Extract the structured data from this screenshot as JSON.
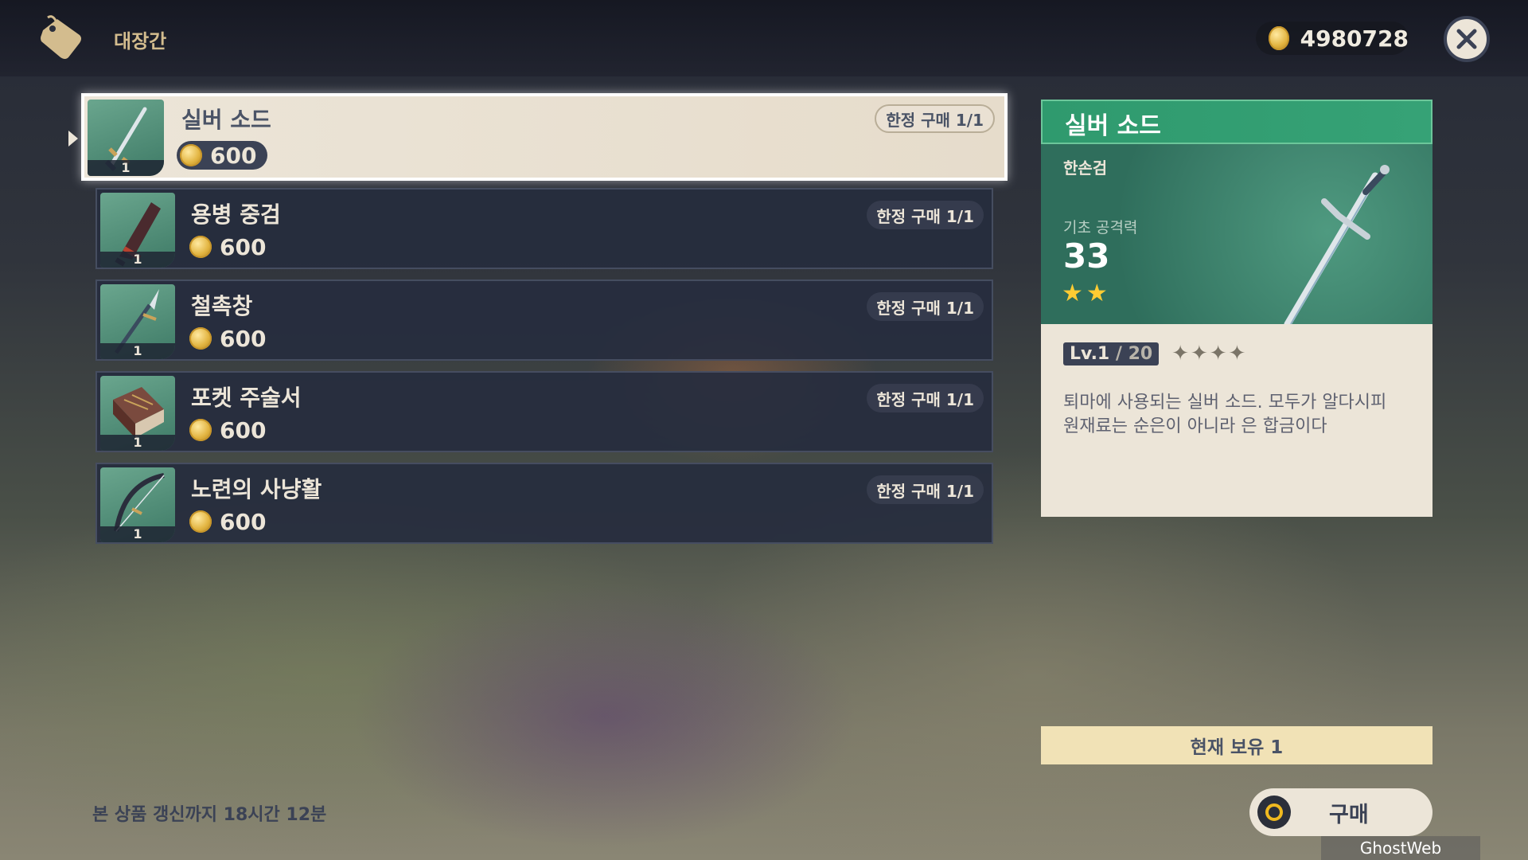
{
  "header": {
    "shop_title": "대장간",
    "currency_amount": "4980728",
    "shop_icon": "price-tag-icon",
    "close_icon": "close-icon"
  },
  "items": [
    {
      "name": "실버 소드",
      "count": "1",
      "price": "600",
      "limit": "한정 구매 1/1",
      "icon": "sword-icon"
    },
    {
      "name": "용병 중검",
      "count": "1",
      "price": "600",
      "limit": "한정 구매 1/1",
      "icon": "claymore-icon"
    },
    {
      "name": "철촉창",
      "count": "1",
      "price": "600",
      "limit": "한정 구매 1/1",
      "icon": "spear-icon"
    },
    {
      "name": "포켓 주술서",
      "count": "1",
      "price": "600",
      "limit": "한정 구매 1/1",
      "icon": "catalyst-book-icon"
    },
    {
      "name": "노련의 사냥활",
      "count": "1",
      "price": "600",
      "limit": "한정 구매 1/1",
      "icon": "bow-icon"
    }
  ],
  "refresh_text": "본 상품 갱신까지 18시간 12분",
  "detail": {
    "name": "실버 소드",
    "type": "한손검",
    "stat_label": "기초 공격력",
    "stat_value": "33",
    "rarity_stars": 2,
    "level": "Lv.1",
    "level_max": " / 20",
    "refinement_stars": "✦✦✦✦",
    "description": "퇴마에 사용되는 실버 소드. 모두가 알다시피 원재료는 순은이 아니라 은 합금이다"
  },
  "owned_text": "현재 보유 1",
  "buy_label": "구매",
  "watermark": "GhostWeb",
  "colors": {
    "accent_green": "#36a276",
    "panel_cream": "#ece5d8",
    "star_gold": "#ffcc33",
    "dark_navy": "#3b4255"
  }
}
